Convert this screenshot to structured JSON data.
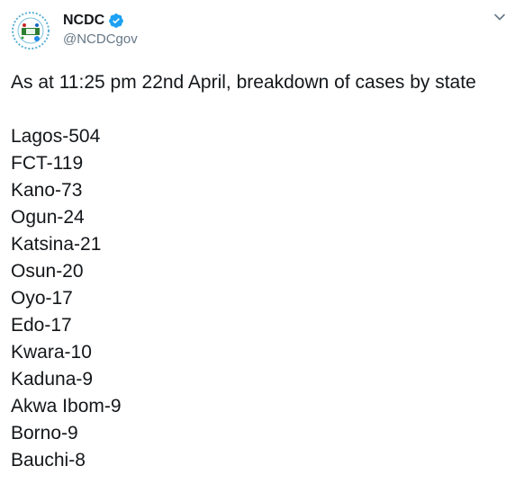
{
  "account": {
    "display_name": "NCDC",
    "handle": "@NCDCgov",
    "verified": true
  },
  "tweet": {
    "intro": "As at 11:25 pm 22nd April, breakdown of cases by state",
    "cases": [
      "Lagos-504",
      "FCT-119",
      "Kano-73",
      "Ogun-24",
      "Katsina-21",
      "Osun-20",
      "Oyo-17",
      "Edo-17",
      "Kwara-10",
      "Kaduna-9",
      "Akwa Ibom-9",
      "Borno-9",
      "Bauchi-8"
    ]
  },
  "icons": {
    "avatar": "ncdc-logo",
    "verified": "verified-badge-icon",
    "menu": "chevron-down-icon"
  },
  "colors": {
    "text": "#14171a",
    "secondary": "#657786",
    "verified": "#1da1f2"
  }
}
